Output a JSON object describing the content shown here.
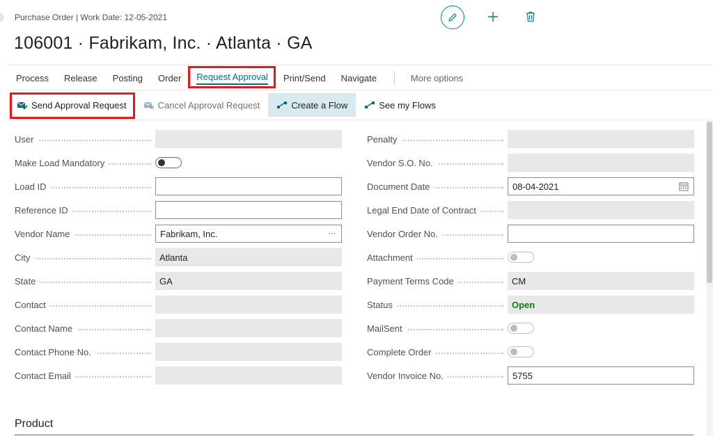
{
  "header": {
    "breadcrumb": "Purchase Order | Work Date: 12-05-2021",
    "title": "106001 · Fabrikam, Inc. · Atlanta · GA"
  },
  "menu": {
    "items": [
      "Process",
      "Release",
      "Posting",
      "Order",
      "Request Approval",
      "Print/Send",
      "Navigate"
    ],
    "more": "More options"
  },
  "actions": {
    "send": "Send Approval Request",
    "cancel": "Cancel Approval Request",
    "create_flow": "Create a Flow",
    "see_flows": "See my Flows"
  },
  "left_fields": [
    {
      "label": "User",
      "value": ""
    },
    {
      "label": "Make Load Mandatory",
      "value": "off"
    },
    {
      "label": "Load ID",
      "value": ""
    },
    {
      "label": "Reference ID",
      "value": ""
    },
    {
      "label": "Vendor Name",
      "value": "Fabrikam, Inc."
    },
    {
      "label": "City",
      "value": "Atlanta"
    },
    {
      "label": "State",
      "value": "GA"
    },
    {
      "label": "Contact",
      "value": ""
    },
    {
      "label": "Contact Name",
      "value": ""
    },
    {
      "label": "Contact Phone No.",
      "value": ""
    },
    {
      "label": "Contact Email",
      "value": ""
    }
  ],
  "right_fields": [
    {
      "label": "Penalty",
      "value": ""
    },
    {
      "label": "Vendor S.O. No.",
      "value": ""
    },
    {
      "label": "Document Date",
      "value": "08-04-2021"
    },
    {
      "label": "Legal End Date of Contract",
      "value": ""
    },
    {
      "label": "Vendor Order No.",
      "value": ""
    },
    {
      "label": "Attachment",
      "value": "off"
    },
    {
      "label": "Payment Terms Code",
      "value": "CM"
    },
    {
      "label": "Status",
      "value": "Open"
    },
    {
      "label": "MailSent",
      "value": "off"
    },
    {
      "label": "Complete Order",
      "value": "off"
    },
    {
      "label": "Vendor Invoice No.",
      "value": "5755"
    }
  ],
  "section": {
    "product": "Product"
  },
  "colors": {
    "accent": "#0b6a87",
    "highlight": "#e8161b",
    "status_open": "#107c10"
  }
}
